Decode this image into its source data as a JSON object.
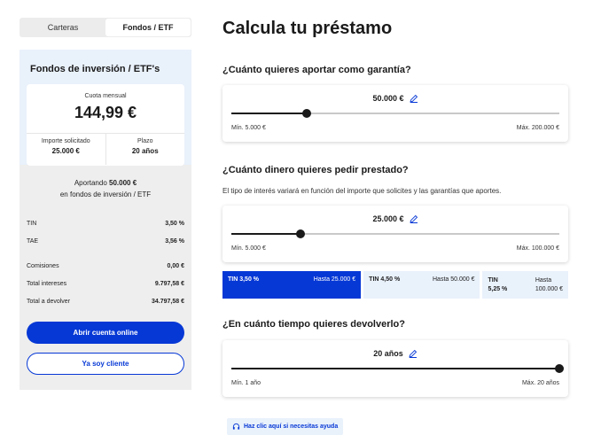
{
  "tabs": [
    {
      "label": "Carteras"
    },
    {
      "label": "Fondos / ETF"
    }
  ],
  "sidebar": {
    "title": "Fondos de inversión / ETF's",
    "quote": {
      "label": "Cuota mensual",
      "amount": "144,99 €",
      "importe_label": "Importe solicitado",
      "importe_value": "25.000 €",
      "plazo_label": "Plazo",
      "plazo_value": "20 años"
    },
    "aportando_prefix": "Aportando",
    "aportando_amount": "50.000 €",
    "aportando_suffix": "en fondos de inversión / ETF",
    "rows": [
      {
        "label": "TIN",
        "value": "3,50 %"
      },
      {
        "label": "TAE",
        "value": "3,56 %"
      },
      {
        "label": "Comisiones",
        "value": "0,00 €"
      },
      {
        "label": "Total intereses",
        "value": "9.797,58 €"
      },
      {
        "label": "Total a devolver",
        "value": "34.797,58 €"
      }
    ],
    "primary_button": "Abrir cuenta online",
    "secondary_button": "Ya soy cliente"
  },
  "main": {
    "title": "Calcula tu préstamo",
    "guarantee": {
      "question": "¿Cuánto quieres aportar como garantía?",
      "value": "50.000 €",
      "min": "Mín. 5.000 €",
      "max": "Máx. 200.000 €",
      "fraction": 0.23
    },
    "loan": {
      "question": "¿Cuánto dinero quieres pedir prestado?",
      "hint": "El tipo de interés variará en función del importe que solicites y las garantías que aportes.",
      "value": "25.000 €",
      "min": "Mín. 5.000 €",
      "max": "Máx. 100.000 €",
      "fraction": 0.21
    },
    "tin_options": [
      {
        "tin": "TIN 3,50 %",
        "hasta": "Hasta 25.000 €"
      },
      {
        "tin": "TIN 4,50 %",
        "hasta": "Hasta 50.000 €"
      },
      {
        "tin_a": "TIN",
        "tin_b": "5,25 %",
        "hasta_a": "Hasta",
        "hasta_b": "100.000 €"
      }
    ],
    "term": {
      "question": "¿En cuánto tiempo quieres devolverlo?",
      "value": "20 años",
      "min": "Mín. 1 año",
      "max": "Máx. 20 años",
      "fraction": 1.0
    },
    "help_link": "Haz clic aquí si necesitas ayuda"
  },
  "colors": {
    "accent": "#0638d6",
    "light_blue": "#e9f1fb",
    "sidebar_bg": "#eeeeee"
  }
}
